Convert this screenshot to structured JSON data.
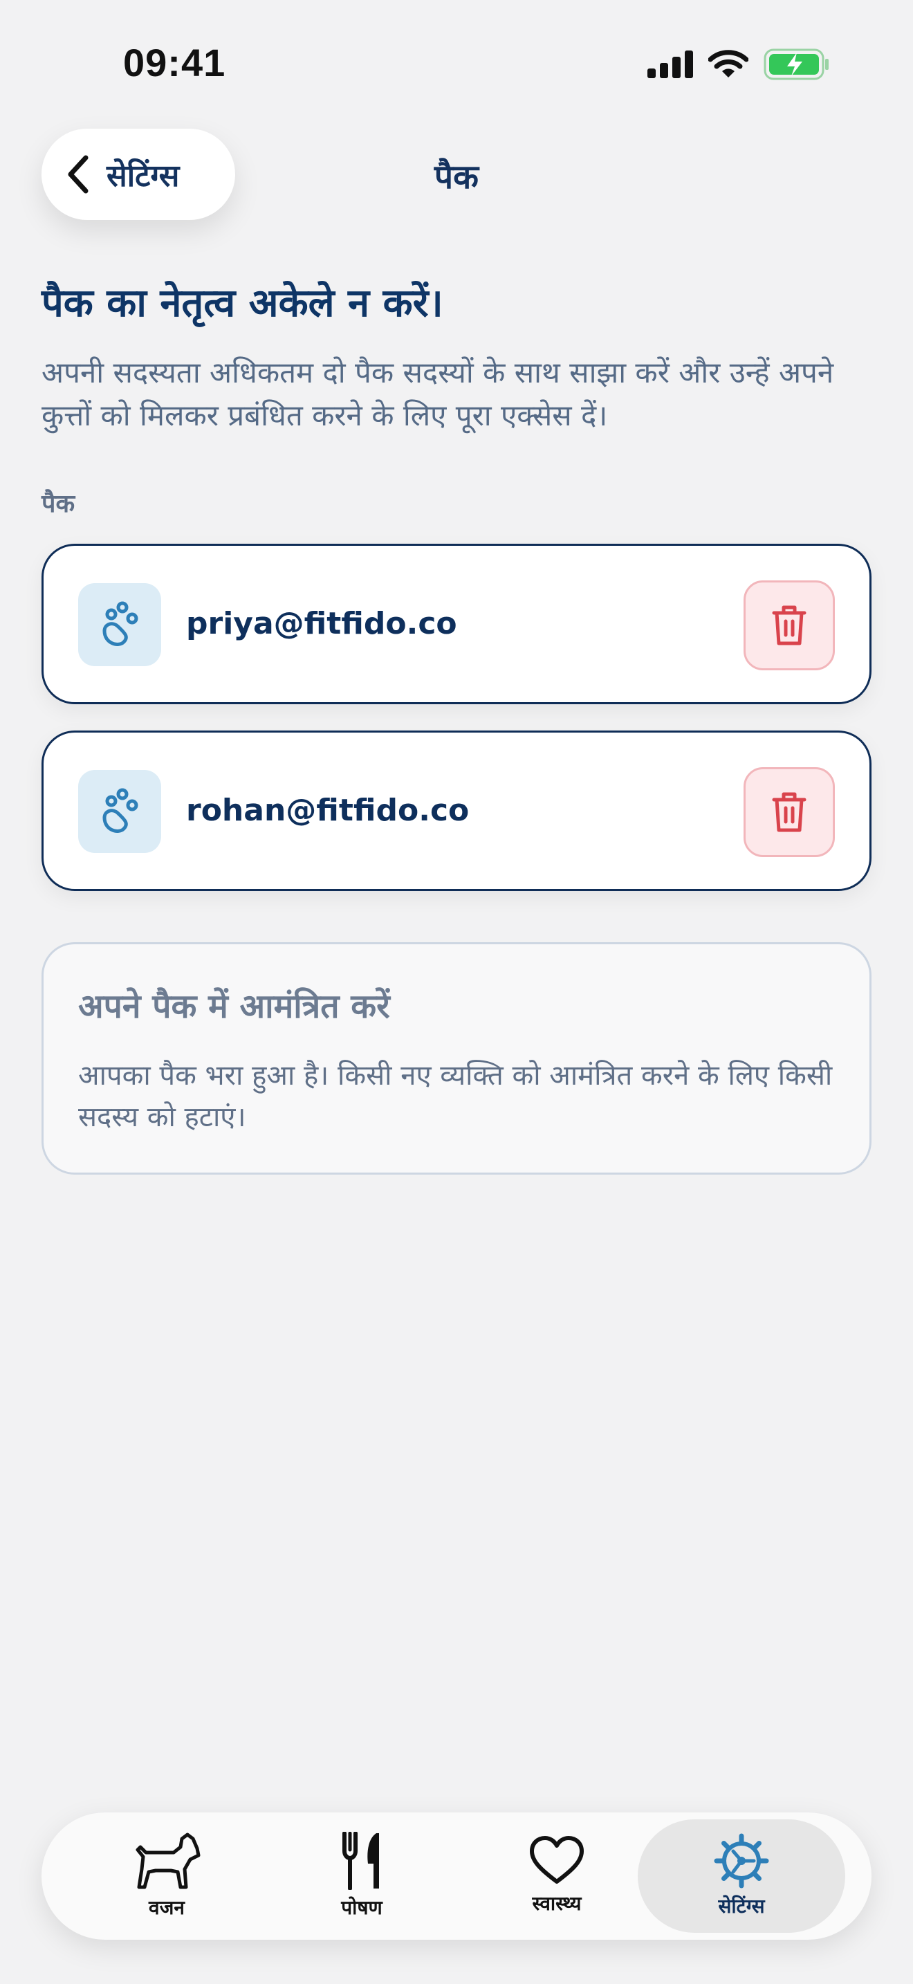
{
  "status_bar": {
    "time": "09:41"
  },
  "nav": {
    "back_label": "सेटिंग्स",
    "title": "पैक"
  },
  "content": {
    "headline": "पैक का नेतृत्व अकेले न करें।",
    "description": "अपनी सदस्यता अधिकतम दो पैक सदस्यों के साथ साझा करें और उन्हें अपने कुत्तों को मिलकर प्रबंधित करने के लिए पूरा एक्सेस दें।",
    "section_label": "पैक",
    "members": [
      {
        "email": "priya@fitfido.co"
      },
      {
        "email": "rohan@fitfido.co"
      }
    ],
    "invite": {
      "title": "अपने पैक में आमंत्रित करें",
      "text": "आपका पैक भरा हुआ है। किसी नए व्यक्ति को आमंत्रित करने के लिए किसी सदस्य को हटाएं।"
    }
  },
  "tab_bar": {
    "tabs": [
      {
        "label": "वजन",
        "icon": "dog-icon"
      },
      {
        "label": "पोषण",
        "icon": "fork-knife-icon"
      },
      {
        "label": "स्वास्थ्य",
        "icon": "heart-icon"
      },
      {
        "label": "सेटिंग्स",
        "icon": "gear-icon",
        "active": true
      }
    ]
  },
  "colors": {
    "background": "#f2f2f3",
    "primary_navy": "#0e2f5c",
    "danger": "#d9434c",
    "danger_bg": "#fde8ea",
    "accent_blue": "#2d7fb8",
    "battery_green": "#34c759"
  }
}
